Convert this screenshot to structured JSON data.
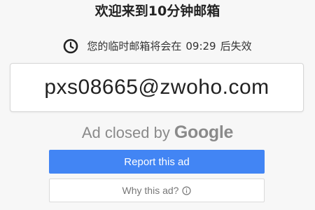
{
  "header": {
    "title": "欢迎来到10分钟邮箱"
  },
  "expiry": {
    "icon": "clock-icon",
    "prefix": "您的临时邮箱将会在",
    "time": "09:29",
    "suffix": "后失效"
  },
  "mailbox": {
    "address": "pxs08665@zwoho.com"
  },
  "ad": {
    "closed_by_text": "Ad closed by",
    "brand": "Google",
    "report_label": "Report this ad",
    "why_label": "Why this ad?",
    "why_icon": "info-icon",
    "accent_color": "#4285f4"
  }
}
